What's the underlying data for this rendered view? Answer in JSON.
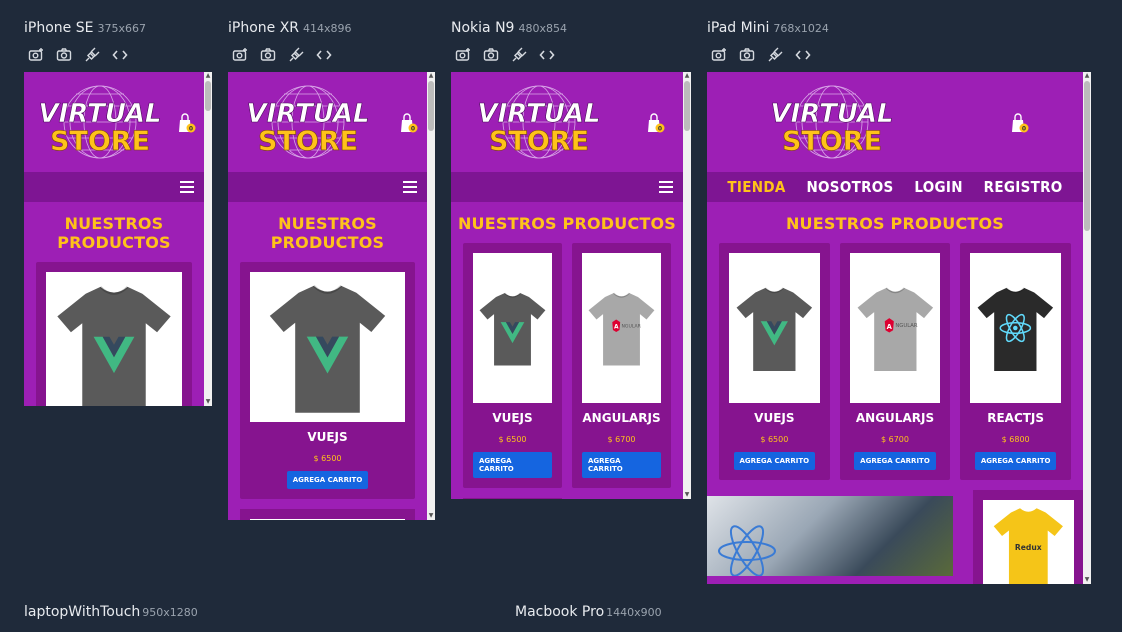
{
  "devices": [
    {
      "name": "iPhone SE",
      "dims": "375x667"
    },
    {
      "name": "iPhone XR",
      "dims": "414x896"
    },
    {
      "name": "Nokia N9",
      "dims": "480x854"
    },
    {
      "name": "iPad Mini",
      "dims": "768x1024"
    }
  ],
  "bottom_devices": [
    {
      "name": "laptopWithTouch",
      "dims": "950x1280"
    },
    {
      "name": "Macbook Pro",
      "dims": "1440x900"
    }
  ],
  "toolbar_icons": [
    "camera-plus-icon",
    "camera-icon",
    "plug-icon",
    "code-icon"
  ],
  "site": {
    "logo_top": "VIRTUAL",
    "logo_bottom": "STORE",
    "cart_count": "0",
    "nav": [
      "TIENDA",
      "NOSOTROS",
      "LOGIN",
      "REGISTRO"
    ],
    "section_title": "NUESTROS PRODUCTOS",
    "add_button": "AGREGA CARRITO",
    "products": [
      {
        "name": "VUEJS",
        "price": "$ 6500",
        "shirt_color": "#5a5a5a",
        "logo": "vue"
      },
      {
        "name": "ANGULARJS",
        "price": "$ 6700",
        "shirt_color": "#a8a8a8",
        "logo": "angular"
      },
      {
        "name": "REACTJS",
        "price": "$ 6800",
        "shirt_color": "#2a2a2a",
        "logo": "react"
      }
    ],
    "redux_label": "Redux"
  },
  "colors": {
    "brand_purple": "#9d1fb5",
    "nav_purple": "#7e1593",
    "accent_yellow": "#ffc21a",
    "button_blue": "#1565e0",
    "canvas_bg": "#1f2a3a"
  }
}
